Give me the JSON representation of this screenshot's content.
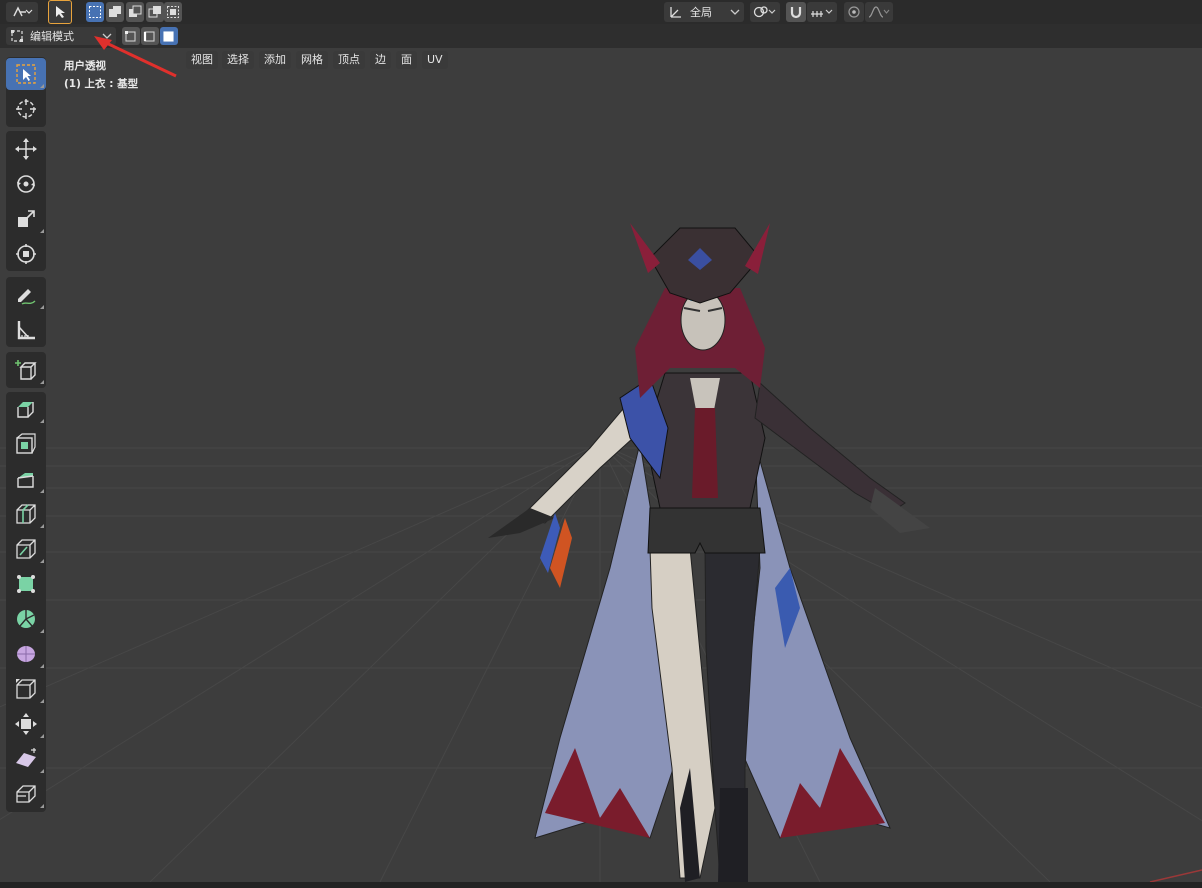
{
  "header": {
    "transform_orientation": "全局",
    "mode": "编辑模式",
    "menus": [
      "视图",
      "选择",
      "添加",
      "网格",
      "顶点",
      "边",
      "面",
      "UV"
    ]
  },
  "viewport": {
    "perspective_label": "用户透视",
    "object_label": "(1) 上衣 : 基型"
  },
  "tools": [
    {
      "name": "select-box"
    },
    {
      "name": "cursor"
    },
    {
      "name": "move"
    },
    {
      "name": "rotate"
    },
    {
      "name": "scale"
    },
    {
      "name": "transform"
    },
    {
      "name": "annotate"
    },
    {
      "name": "measure"
    },
    {
      "name": "add-cube"
    },
    {
      "name": "extrude-region"
    },
    {
      "name": "inset-faces"
    },
    {
      "name": "bevel"
    },
    {
      "name": "loop-cut"
    },
    {
      "name": "knife"
    },
    {
      "name": "poly-build"
    },
    {
      "name": "spin"
    },
    {
      "name": "smooth"
    },
    {
      "name": "edge-slide"
    },
    {
      "name": "shrink-fatten"
    },
    {
      "name": "shear"
    },
    {
      "name": "rip-region"
    }
  ],
  "colors": {
    "background": "#3d3d3d",
    "grid": "#4a4a4a",
    "accent": "#4772b3",
    "annotation_arrow": "#e0302c"
  }
}
